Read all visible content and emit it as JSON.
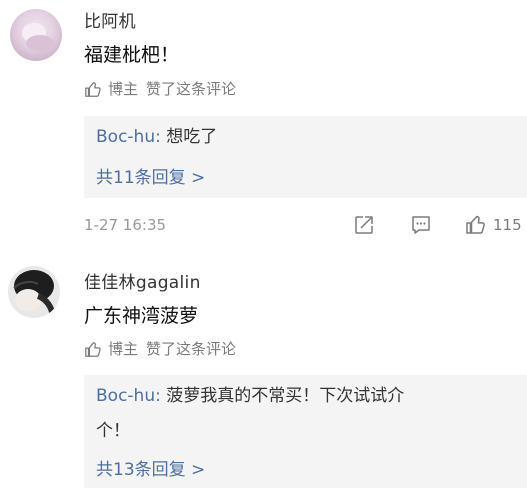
{
  "comments": [
    {
      "username": "比阿机",
      "text": "福建枇杷！",
      "liked_label": "博主",
      "liked_suffix": "赞了这条评论",
      "reply": {
        "author": "Boc-hu:",
        "text": "想吃了",
        "count_label": "共11条回复 >"
      },
      "time": "1-27 16:35",
      "like_count": "115"
    },
    {
      "username": "佳佳林gagalin",
      "text": "广东神湾菠萝",
      "liked_label": "博主",
      "liked_suffix": "赞了这条评论",
      "reply": {
        "author": "Boc-hu:",
        "text_line1": "菠萝我真的不常买！下次试试介",
        "text_line2": "个！",
        "count_label": "共13条回复 >"
      }
    }
  ],
  "icons": {
    "like": "thumbs-up-icon",
    "share": "share-icon",
    "comment": "comment-icon"
  },
  "colors": {
    "link": "#4d6fa0",
    "reply_bg": "#f4f4f4",
    "meta": "#9a9a9a"
  }
}
